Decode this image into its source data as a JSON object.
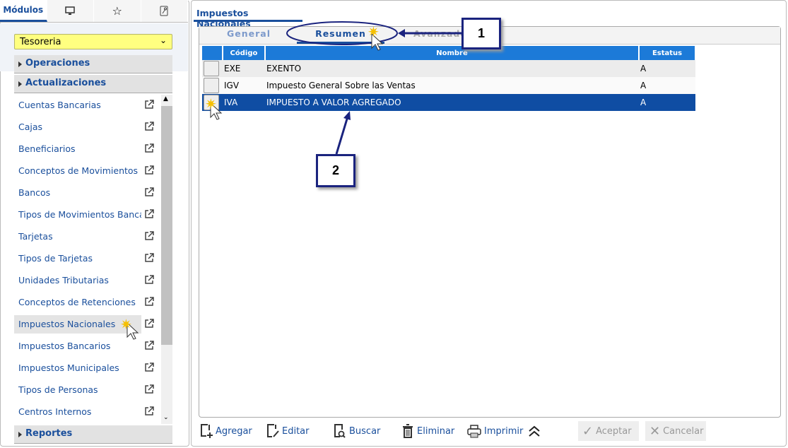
{
  "left": {
    "tabs": [
      {
        "label": "Módulos",
        "icon": "modules"
      },
      {
        "icon": "monitor-icon"
      },
      {
        "icon": "star-icon"
      },
      {
        "icon": "wrench-icon"
      }
    ],
    "module_select": "Tesoreria",
    "sections": [
      "Operaciones",
      "Actualizaciones",
      "Reportes"
    ],
    "items": [
      "Cuentas Bancarias",
      "Cajas",
      "Beneficiarios",
      "Conceptos de Movimientos",
      "Bancos",
      "Tipos de Movimientos Bancarios",
      "Tarjetas",
      "Tipos de Tarjetas",
      "Unidades Tributarias",
      "Conceptos de Retenciones",
      "Impuestos Nacionales",
      "Impuestos Bancarios",
      "Impuestos Municipales",
      "Tipos de Personas",
      "Centros Internos"
    ]
  },
  "main": {
    "title": "Impuestos Nacionales",
    "subtabs": [
      "General",
      "Resumen",
      "Avanzado"
    ],
    "columns": [
      "Código",
      "Nombre",
      "Estatus"
    ],
    "rows": [
      {
        "code": "EXE",
        "name": "EXENTO",
        "status": "A"
      },
      {
        "code": "IGV",
        "name": "Impuesto General Sobre las Ventas",
        "status": "A"
      },
      {
        "code": "IVA",
        "name": "IMPUESTO A VALOR AGREGADO",
        "status": "A"
      }
    ],
    "toolbar": {
      "add": "Agregar",
      "edit": "Editar",
      "search": "Buscar",
      "delete": "Eliminar",
      "print": "Imprimir",
      "accept": "Aceptar",
      "cancel": "Cancelar"
    }
  },
  "callouts": [
    "1",
    "2"
  ],
  "colors": {
    "accent": "#1a4f9c",
    "header": "#1c7ad8",
    "selected": "#0f4da3"
  }
}
